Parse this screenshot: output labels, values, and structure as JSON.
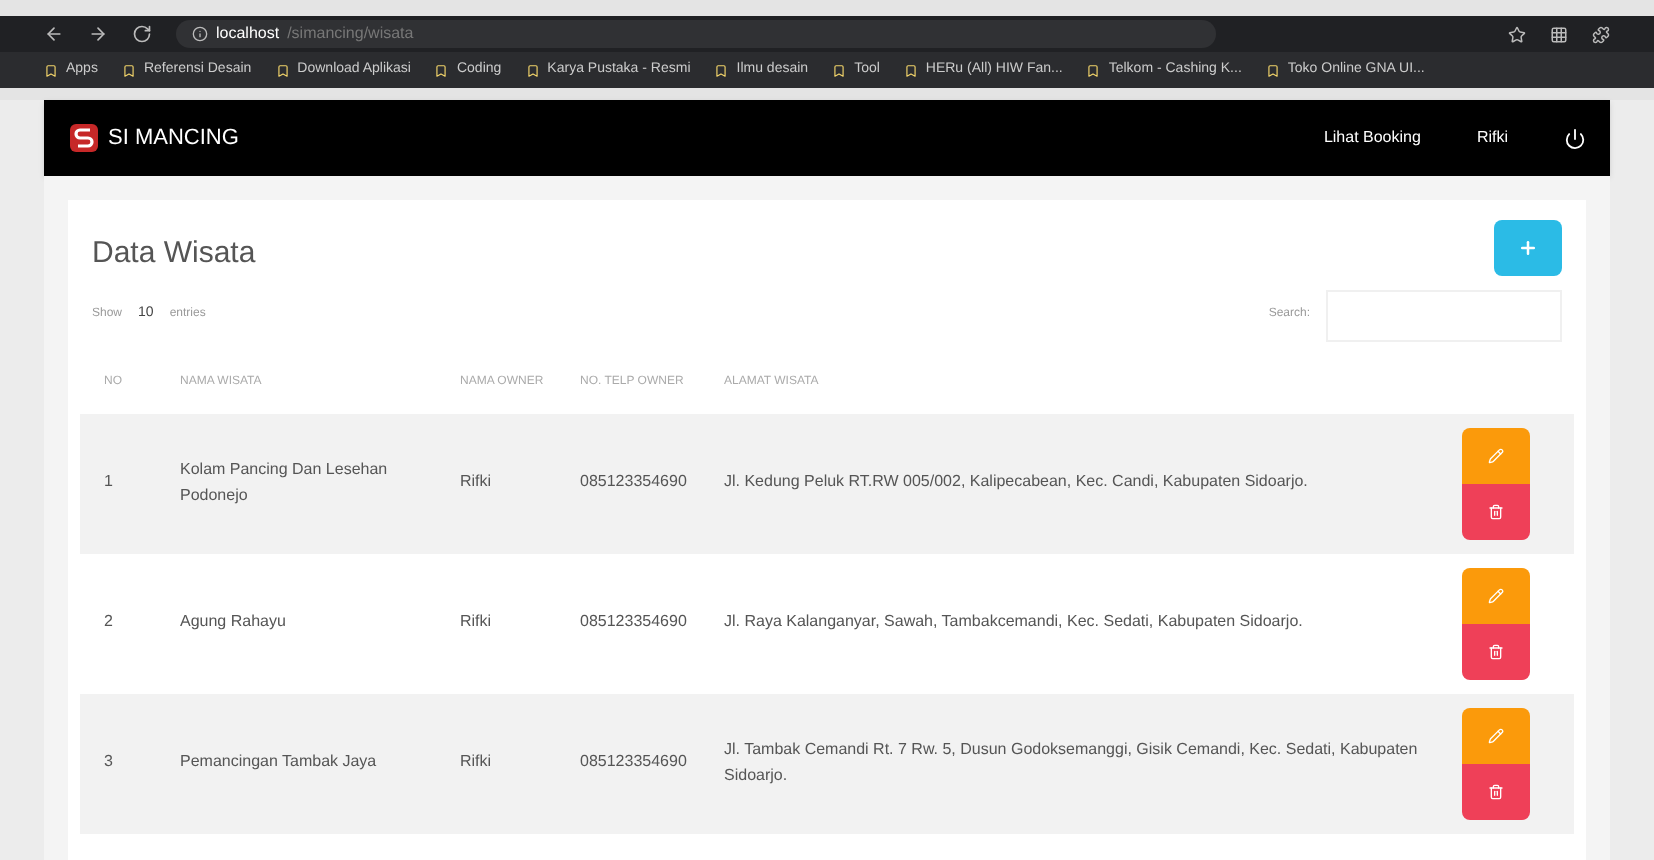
{
  "browser": {
    "address": "localhost",
    "address_path": "/simancing/wisata",
    "bookmarks": [
      "Apps",
      "Referensi Desain",
      "Download Aplikasi",
      "Coding",
      "Karya Pustaka - Resmi",
      "Ilmu desain",
      "Tool",
      "HERu (All) HIW Fan...",
      "Telkom - Cashing K...",
      "Toko Online GNA UI..."
    ]
  },
  "navbar": {
    "brand": "SI MANCING",
    "links": [
      "Lihat Booking",
      "Rifki"
    ]
  },
  "page": {
    "title": "Data Wisata",
    "show_label": "Show",
    "entries_value": "10",
    "entries_label": "entries",
    "search_label": "Search:"
  },
  "table": {
    "columns": [
      "NO",
      "NAMA WISATA",
      "NAMA OWNER",
      "NO. TELP OWNER",
      "ALAMAT WISATA"
    ],
    "rows": [
      {
        "no": "1",
        "name": "Kolam Pancing Dan Lesehan Podonejo",
        "owner": "Rifki",
        "phone": "085123354690",
        "address": "Jl. Kedung Peluk RT.RW 005/002, Kalipecabean, Kec. Candi, Kabupaten Sidoarjo."
      },
      {
        "no": "2",
        "name": "Agung Rahayu",
        "owner": "Rifki",
        "phone": "085123354690",
        "address": "Jl. Raya Kalanganyar, Sawah, Tambakcemandi, Kec. Sedati, Kabupaten Sidoarjo."
      },
      {
        "no": "3",
        "name": "Pemancingan Tambak Jaya",
        "owner": "Rifki",
        "phone": "085123354690",
        "address": "Jl. Tambak Cemandi Rt. 7 Rw. 5, Dusun Godoksemanggi, Gisik Cemandi, Kec. Sedati, Kabupaten Sidoarjo."
      }
    ]
  }
}
